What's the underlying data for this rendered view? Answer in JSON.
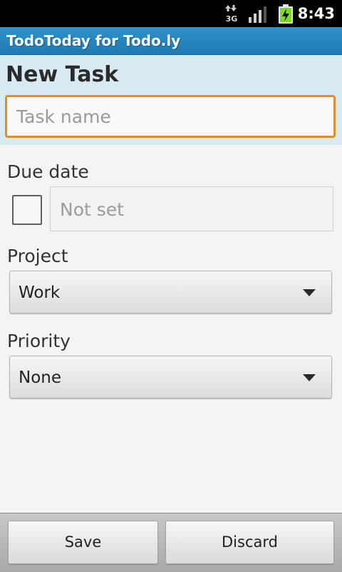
{
  "status_bar": {
    "network": "3G",
    "time": "8:43"
  },
  "app": {
    "title": "TodoToday for Todo.ly"
  },
  "form": {
    "title": "New Task",
    "task_name": {
      "placeholder": "Task name",
      "value": ""
    },
    "due_date": {
      "label": "Due date",
      "checked": false,
      "value": "Not set"
    },
    "project": {
      "label": "Project",
      "selected": "Work"
    },
    "priority": {
      "label": "Priority",
      "selected": "None"
    }
  },
  "actions": {
    "save_label": "Save",
    "discard_label": "Discard"
  },
  "colors": {
    "app_bar": "#1f7ab3",
    "header_background": "#d9ebf2",
    "focus_border": "#e38d25",
    "battery_green": "#7ddc1f"
  },
  "icons": {
    "network": "3g-data-icon",
    "signal": "signal-strength-icon",
    "battery": "battery-charging-icon",
    "dropdown": "chevron-down-icon"
  }
}
